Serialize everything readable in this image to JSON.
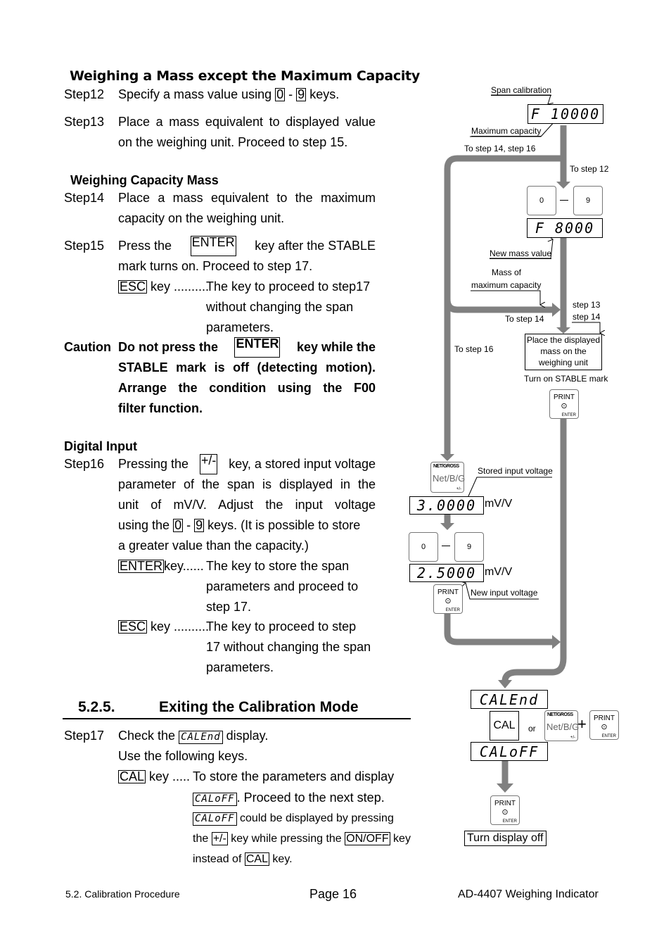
{
  "sections": {
    "except_max": {
      "heading": "Weighing a Mass except the Maximum Capacity",
      "step12": {
        "label": "Step12",
        "pre": "Specify a mass value using",
        "key0": "0",
        "dash": "-",
        "key9": "9",
        "post": "keys."
      },
      "step13": {
        "label": "Step13",
        "line1": "Place a mass equivalent to displayed value",
        "line2": "on the weighing unit. Proceed to step 15."
      }
    },
    "capacity_mass": {
      "heading": "Weighing Capacity Mass",
      "step14": {
        "label": "Step14",
        "line1": "Place a mass equivalent to the maximum",
        "line2": "capacity on the weighing unit."
      },
      "step15": {
        "label": "Step15",
        "line1_pre": "Press the",
        "key": "ENTER",
        "line1_post": "key after the STABLE",
        "line2": "mark turns on. Proceed to step 17.",
        "esc_key": "ESC",
        "esc_dots": "key ..........",
        "esc_desc": [
          "The key to proceed to step17",
          "without changing the span",
          "parameters."
        ]
      }
    },
    "caution": {
      "label": "Caution",
      "line1_pre": "Do not press the",
      "key": "ENTER",
      "line1_post": "key while the",
      "line2": "STABLE mark is off (detecting motion).",
      "line3": "Arrange the condition using the F00",
      "line4": "filter function."
    },
    "digital_input": {
      "heading": "Digital Input",
      "step16": {
        "label": "Step16",
        "line1_pre": "Pressing the",
        "key_pm": "+/-",
        "line1_post": "key, a stored input voltage",
        "line2": "parameter of the span is displayed in the",
        "line3": "unit of mV/V. Adjust the input voltage",
        "line4_pre": "using the",
        "key0": "0",
        "dash": "-",
        "key9": "9",
        "line4_post": "keys. (It is possible to store",
        "line5": "a greater value than the capacity.)",
        "enter_key": "ENTER",
        "enter_dots": "key......",
        "enter_desc": [
          "The key to store the span",
          "parameters and proceed to",
          "step 17."
        ],
        "esc_key": "ESC",
        "esc_dots": "key ..........",
        "esc_desc": [
          "The key to proceed to step",
          "17 without changing the span",
          "parameters."
        ]
      }
    },
    "exiting": {
      "number": "5.2.5.",
      "title": "Exiting the Calibration Mode",
      "step17": {
        "label": "Step17",
        "line1_pre": "Check the",
        "disp": "CALEnd",
        "line1_post": "display.",
        "line2": "Use the following keys.",
        "cal_key": "CAL",
        "cal_dots": "key .....",
        "cal_desc1": "To store the parameters and display",
        "caloff": "CALoFF",
        "cal_desc2": ". Proceed to the next step.",
        "cal_desc3": "could be displayed by pressing",
        "cal_desc4_pre": "the",
        "key_pm": "+/-",
        "cal_desc4_mid": "key while pressing the",
        "key_onoff": "ON/OFF",
        "cal_desc4_post": "key",
        "cal_desc5_pre": "instead of",
        "key_cal2": "CAL",
        "cal_desc5_post": "key."
      }
    }
  },
  "diagram": {
    "span_calibration": "Span calibration",
    "display_f10000": "F 10000",
    "maximum_capacity": "Maximum capacity",
    "to_step_14_16": "To step 14, step 16",
    "to_step_12": "To step 12",
    "key_0": "0",
    "key_9": "9",
    "display_f8000": "F  8000",
    "new_mass_value": "New mass value",
    "mass_of": "Mass of",
    "maximum_capacity2": "maximum capacity",
    "step_13": "step 13",
    "step_14": "step 14",
    "to_step_14": "To step 14",
    "to_step_16": "To step 16",
    "place_box": [
      "Place the displayed",
      "mass on the",
      "weighing unit"
    ],
    "turn_on_stable": "Turn on STABLE mark",
    "print_key": {
      "top": "PRINT",
      "symbol": "⊙",
      "bottom": "ENTER"
    },
    "net_key": {
      "top": "NET/GROSS",
      "mid": "Net/B/G",
      "bottom": "+/-"
    },
    "stored_input_voltage": "Stored input voltage",
    "display_30000": "3.0000",
    "unit_mvv": "mV/V",
    "display_25000": "2.5000",
    "new_input_voltage": "New input voltage",
    "display_calend": "CALEnd",
    "cal_key": "CAL",
    "or": "or",
    "plus": "+",
    "display_caloff": "CALoFF",
    "turn_display_off": "Turn display off"
  },
  "footer": {
    "section": "5.2. Calibration Procedure",
    "page": "Page 16",
    "product": "AD-4407 Weighing Indicator"
  },
  "colors": {
    "flow_arrow": "#808080",
    "text": "#000000"
  }
}
